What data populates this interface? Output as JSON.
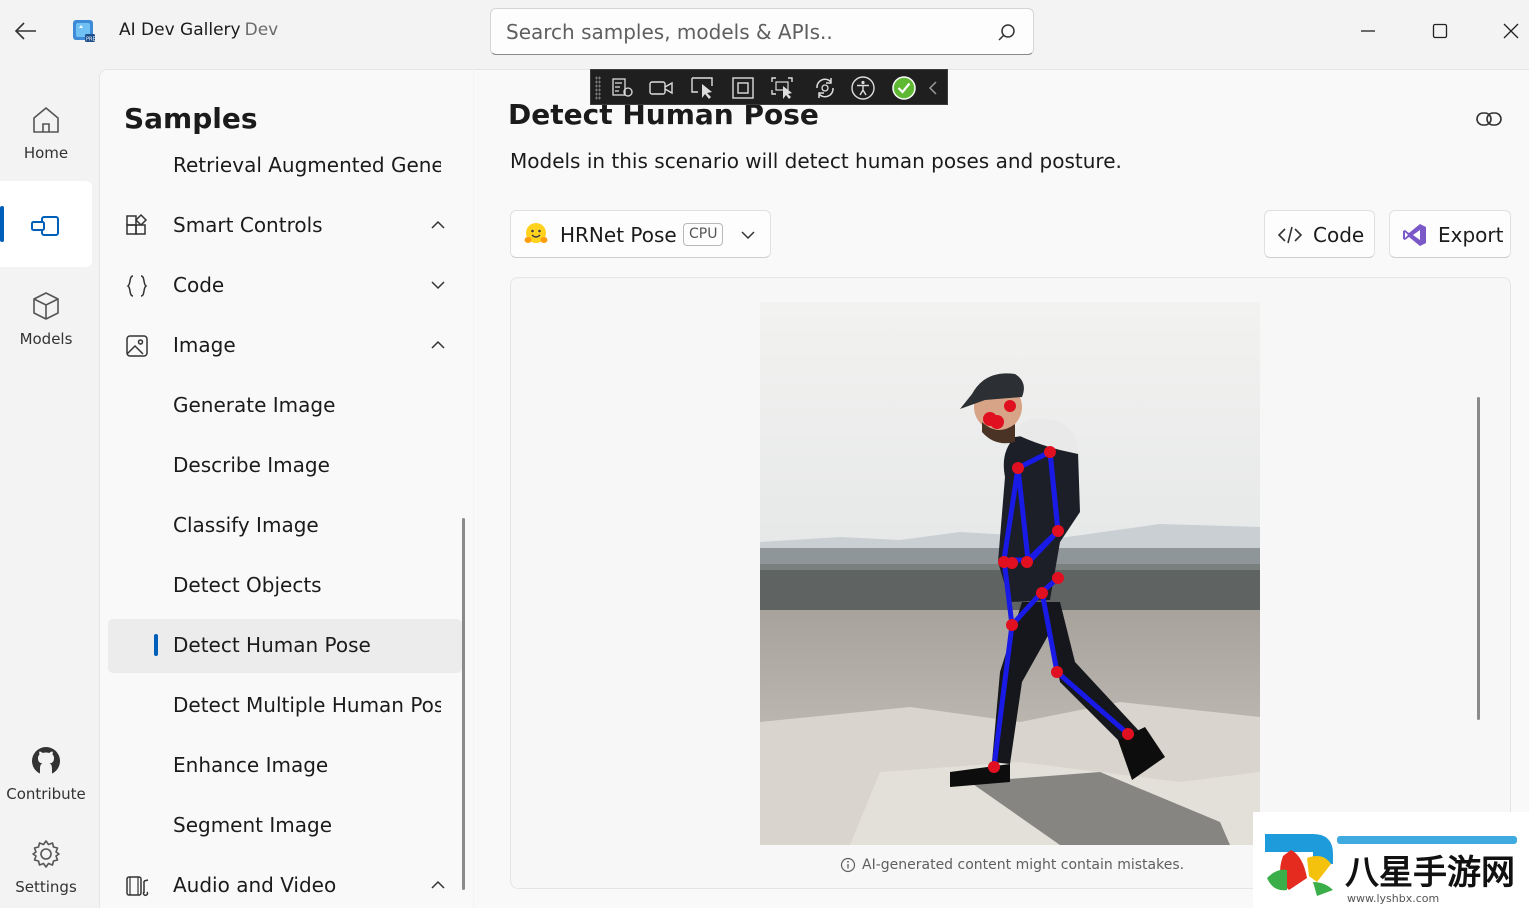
{
  "titlebar": {
    "app_name": "AI Dev Gallery",
    "app_variant": "Dev",
    "search_placeholder": "Search samples, models & APIs.."
  },
  "rail": {
    "items": [
      {
        "label": "Home",
        "icon": "home-icon"
      },
      {
        "label": "",
        "icon": "samples-icon",
        "active": true
      },
      {
        "label": "Models",
        "icon": "cube-icon"
      },
      {
        "label": "Contribute",
        "icon": "github-icon"
      },
      {
        "label": "Settings",
        "icon": "gear-icon"
      }
    ]
  },
  "samples": {
    "title": "Samples",
    "items": [
      {
        "label": "Retrieval Augmented Genera",
        "level": 2
      },
      {
        "label": "Smart Controls",
        "level": 1,
        "icon": "smart-controls-icon",
        "expanded": true
      },
      {
        "label": "Code",
        "level": 1,
        "icon": "braces-icon",
        "expanded": false
      },
      {
        "label": "Image",
        "level": 1,
        "icon": "image-icon",
        "expanded": true
      },
      {
        "label": "Generate Image",
        "level": 2
      },
      {
        "label": "Describe Image",
        "level": 2
      },
      {
        "label": "Classify Image",
        "level": 2
      },
      {
        "label": "Detect Objects",
        "level": 2
      },
      {
        "label": "Detect Human Pose",
        "level": 2,
        "selected": true
      },
      {
        "label": "Detect Multiple Human Pose",
        "level": 2
      },
      {
        "label": "Enhance Image",
        "level": 2
      },
      {
        "label": "Segment Image",
        "level": 2
      },
      {
        "label": "Audio and Video",
        "level": 1,
        "icon": "audio-video-icon",
        "expanded": true
      }
    ]
  },
  "page": {
    "title": "Detect Human Pose",
    "description": "Models in this scenario will detect human poses and posture.",
    "model": {
      "name": "HRNet Pose",
      "device": "CPU"
    },
    "code_button": "Code",
    "export_button": "Export",
    "ai_notice": "AI-generated content might contain mistakes."
  },
  "watermark": {
    "text": "八星手游网",
    "url_text": "www.lyshbx.com"
  },
  "colors": {
    "accent": "#005fb8",
    "skeleton": "#1a1ae6",
    "keypoint": "#e01020"
  }
}
